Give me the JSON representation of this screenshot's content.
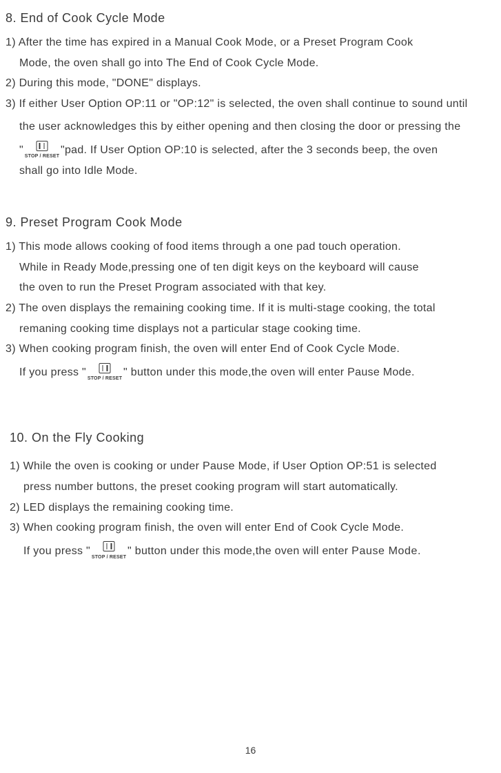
{
  "s8": {
    "heading": "8. End of Cook Cycle Mode",
    "p1a": "1) After the time has expired in a Manual Cook Mode, or a Preset Program Cook",
    "p1b": "Mode, the oven shall go into The End of Cook Cycle Mode.",
    "p2": "2) During this mode, \"DONE\" displays.",
    "p3a": "3) If either User Option OP:11 or \"OP:12\" is selected, the oven shall continue to sound until",
    "p3b": "the user acknowledges this by either opening and then  closing the door or pressing the",
    "p3c_pre": "\"",
    "p3c_post": "\"pad. If User Option OP:10 is selected, after the 3 seconds beep, the oven",
    "p3d": "shall go into  Idle Mode."
  },
  "s9": {
    "heading": "9. Preset Program Cook Mode",
    "p1a": "1) This mode allows cooking of food items through a one pad touch operation.",
    "p1b": "While in Ready Mode,pressing one of ten digit keys on the keyboard will cause",
    "p1c": "the oven to run the Preset Program associated with that key.",
    "p2a": "2) The oven  displays the remaining cooking time. If it is multi-stage cooking, the total",
    "p2b": "remaning  cooking time displays not a particular stage cooking time.",
    "p3": "3) When cooking program finish, the oven will enter End of Cook Cycle Mode.",
    "p4_pre": "If you press \"",
    "p4_post": "\" button under this mode,the oven will enter Pause Mode."
  },
  "s10": {
    "heading": "10. On the Fly Cooking",
    "p1a": "1) While the oven is cooking or under Pause Mode, if User Option OP:51 is selected",
    "p1b": "press number buttons, the preset cooking program will start automatically.",
    "p2": "2) LED displays the remaining cooking time.",
    "p3": "3) When cooking program finish, the oven will enter End of Cook Cycle Mode.",
    "p4_pre": "If you press \"",
    "p4_post": "\" button under this mode,the oven will enter ",
    "p4_end": "Pause Mode."
  },
  "icon": {
    "label": "STOP / RESET"
  },
  "page": "16"
}
